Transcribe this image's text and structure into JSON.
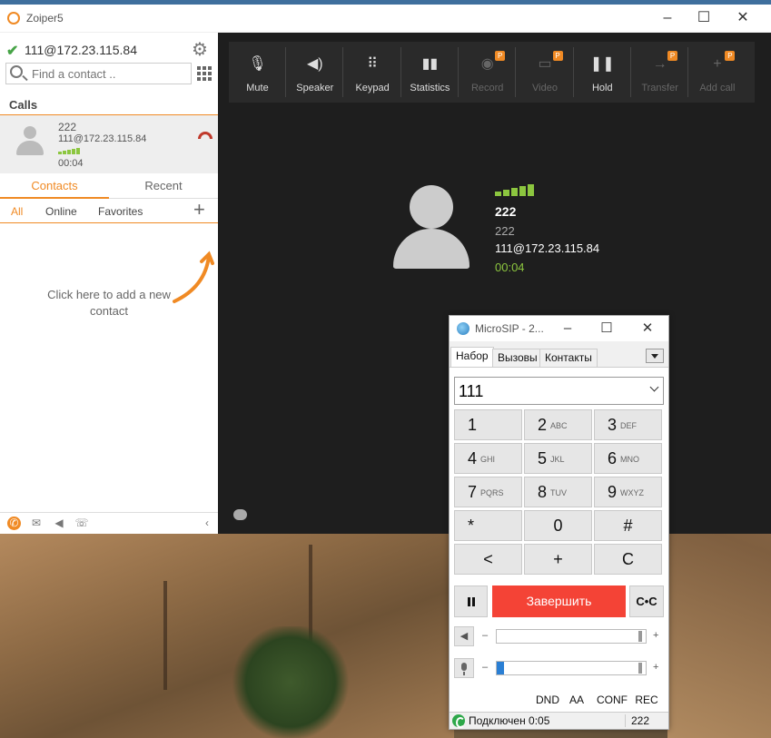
{
  "zoiper": {
    "title": "Zoiper5",
    "account": "111@172.23.115.84",
    "search_placeholder": "Find a contact ..",
    "calls_header": "Calls",
    "call_item": {
      "name": "222",
      "account": "111@172.23.115.84",
      "duration": "00:04"
    },
    "tabs": {
      "contacts": "Contacts",
      "recent": "Recent"
    },
    "subtabs": {
      "all": "All",
      "online": "Online",
      "favorites": "Favorites"
    },
    "empty_hint": "Click here to add a new contact",
    "toolbar": [
      {
        "label": "Mute",
        "icon": "mic-off-icon",
        "enabled": true,
        "premium": false
      },
      {
        "label": "Speaker",
        "icon": "speaker-icon",
        "enabled": true,
        "premium": false
      },
      {
        "label": "Keypad",
        "icon": "keypad-icon",
        "enabled": true,
        "premium": false
      },
      {
        "label": "Statistics",
        "icon": "statistics-icon",
        "enabled": true,
        "premium": false
      },
      {
        "label": "Record",
        "icon": "record-icon",
        "enabled": false,
        "premium": true
      },
      {
        "label": "Video",
        "icon": "video-icon",
        "enabled": false,
        "premium": true
      },
      {
        "label": "Hold",
        "icon": "pause-icon",
        "enabled": true,
        "premium": false
      },
      {
        "label": "Transfer",
        "icon": "transfer-icon",
        "enabled": false,
        "premium": true
      },
      {
        "label": "Add call",
        "icon": "plus-icon",
        "enabled": false,
        "premium": true
      }
    ],
    "premium_badge": "P",
    "peer": {
      "name": "222",
      "number": "222",
      "account": "111@172.23.115.84",
      "duration": "00:04"
    },
    "colors": {
      "accent": "#f08a24",
      "signal": "#8cc63f",
      "dark_bg": "#1e1e1e"
    }
  },
  "microsip": {
    "title": "MicroSIP - 2...",
    "tabs": {
      "dial": "Набор",
      "calls": "Вызовы",
      "contacts": "Контакты"
    },
    "number": "111",
    "keys": [
      {
        "digit": "1",
        "letters": ""
      },
      {
        "digit": "2",
        "letters": "ABC"
      },
      {
        "digit": "3",
        "letters": "DEF"
      },
      {
        "digit": "4",
        "letters": "GHI"
      },
      {
        "digit": "5",
        "letters": "JKL"
      },
      {
        "digit": "6",
        "letters": "MNO"
      },
      {
        "digit": "7",
        "letters": "PQRS"
      },
      {
        "digit": "8",
        "letters": "TUV"
      },
      {
        "digit": "9",
        "letters": "WXYZ"
      },
      {
        "digit": "*",
        "letters": ""
      },
      {
        "digit": "0",
        "letters": ""
      },
      {
        "digit": "#",
        "letters": ""
      },
      {
        "digit": "<",
        "letters": ""
      },
      {
        "digit": "+",
        "letters": ""
      },
      {
        "digit": "C",
        "letters": ""
      }
    ],
    "end_call": "Завершить",
    "transfer_label": "C•C",
    "volume_minus": "–",
    "volume_plus": "+",
    "speaker_level": 1.0,
    "mic_level": 0.05,
    "buttons": {
      "dnd": "DND",
      "aa": "AA",
      "conf": "CONF",
      "rec": "REC"
    },
    "status": "Подключен 0:05",
    "status_peer": "222",
    "colors": {
      "end_call": "#f44336",
      "status_ok": "#2ea84a"
    }
  }
}
